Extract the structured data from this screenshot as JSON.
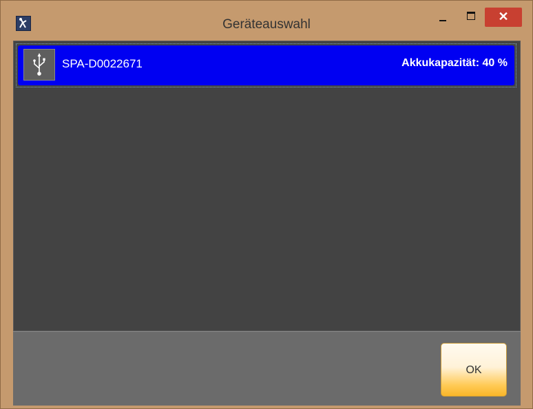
{
  "window": {
    "title": "Geräteauswahl",
    "close_glyph": "✕"
  },
  "icons": {
    "app": "app-icon",
    "device": "usb-icon",
    "minimize": "minimize-icon",
    "maximize": "maximize-icon",
    "close": "close-icon"
  },
  "devices": [
    {
      "name": "SPA-D0022671",
      "battery": "Akkukapazität: 40 %",
      "selected": true
    }
  ],
  "footer": {
    "ok_label": "OK"
  },
  "colors": {
    "selection": "#0000f2",
    "close_button": "#c84031",
    "frame": "#c59a6e"
  }
}
